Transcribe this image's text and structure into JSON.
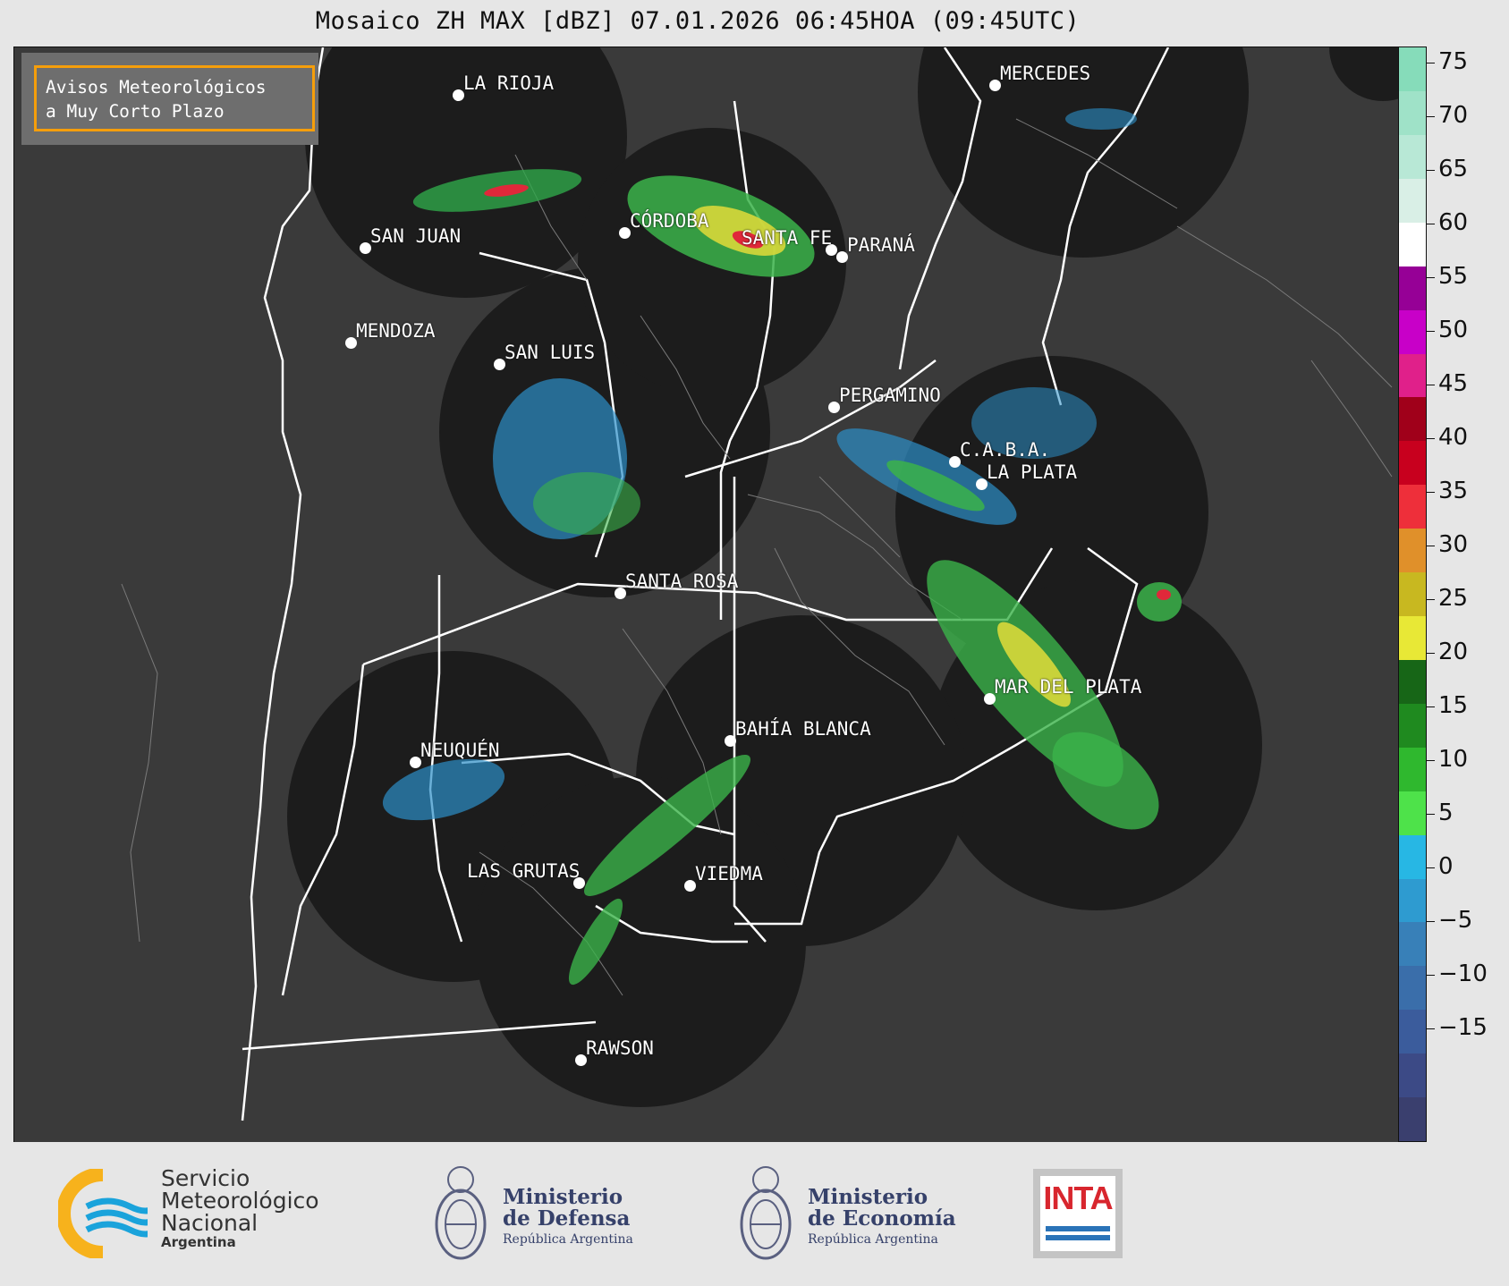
{
  "title": "Mosaico ZH MAX [dBZ] 07.01.2026 06:45HOA (09:45UTC)",
  "notice": {
    "line1": "Avisos Meteorológicos",
    "line2": "a Muy Corto Plazo"
  },
  "cities": [
    {
      "name": "LA RIOJA"
    },
    {
      "name": "MERCEDES"
    },
    {
      "name": "CÓRDOBA"
    },
    {
      "name": "SAN JUAN"
    },
    {
      "name": "SANTA FE"
    },
    {
      "name": "PARANÁ"
    },
    {
      "name": "MENDOZA"
    },
    {
      "name": "SAN LUIS"
    },
    {
      "name": "PERGAMINO"
    },
    {
      "name": "C.A.B.A."
    },
    {
      "name": "LA PLATA"
    },
    {
      "name": "SANTA ROSA"
    },
    {
      "name": "MAR DEL PLATA"
    },
    {
      "name": "BAHÍA BLANCA"
    },
    {
      "name": "NEUQUÉN"
    },
    {
      "name": "LAS GRUTAS"
    },
    {
      "name": "VIEDMA"
    },
    {
      "name": "RAWSON"
    }
  ],
  "colorbar": {
    "unit": "dBZ",
    "ticks": [
      "75",
      "70",
      "65",
      "60",
      "55",
      "50",
      "45",
      "40",
      "35",
      "30",
      "25",
      "20",
      "15",
      "10",
      "5",
      "0",
      "−5",
      "−10",
      "−15"
    ],
    "colors": [
      "#3a3f6e",
      "#3c4a86",
      "#3b5c9c",
      "#3a6eaa",
      "#3880b8",
      "#2e9bd0",
      "#27b7e4",
      "#4ee24a",
      "#2fb82e",
      "#1f8a1f",
      "#176617",
      "#e8e836",
      "#c8b820",
      "#e0902a",
      "#ee2f3a",
      "#c8001e",
      "#a0001a",
      "#e0208a",
      "#c800c8",
      "#960096",
      "#ffffff",
      "#d9efe6",
      "#b8e8d6",
      "#9fe2c8",
      "#86dcba"
    ]
  },
  "footer": {
    "smn": {
      "line1": "Servicio",
      "line2": "Meteorológico",
      "line3": "Nacional",
      "line4": "Argentina"
    },
    "defensa": {
      "line1": "Ministerio",
      "line2": "de Defensa",
      "sub": "República Argentina"
    },
    "economia": {
      "line1": "Ministerio",
      "line2": "de Economía",
      "sub": "República Argentina"
    },
    "inta": {
      "label": "INTA"
    }
  }
}
